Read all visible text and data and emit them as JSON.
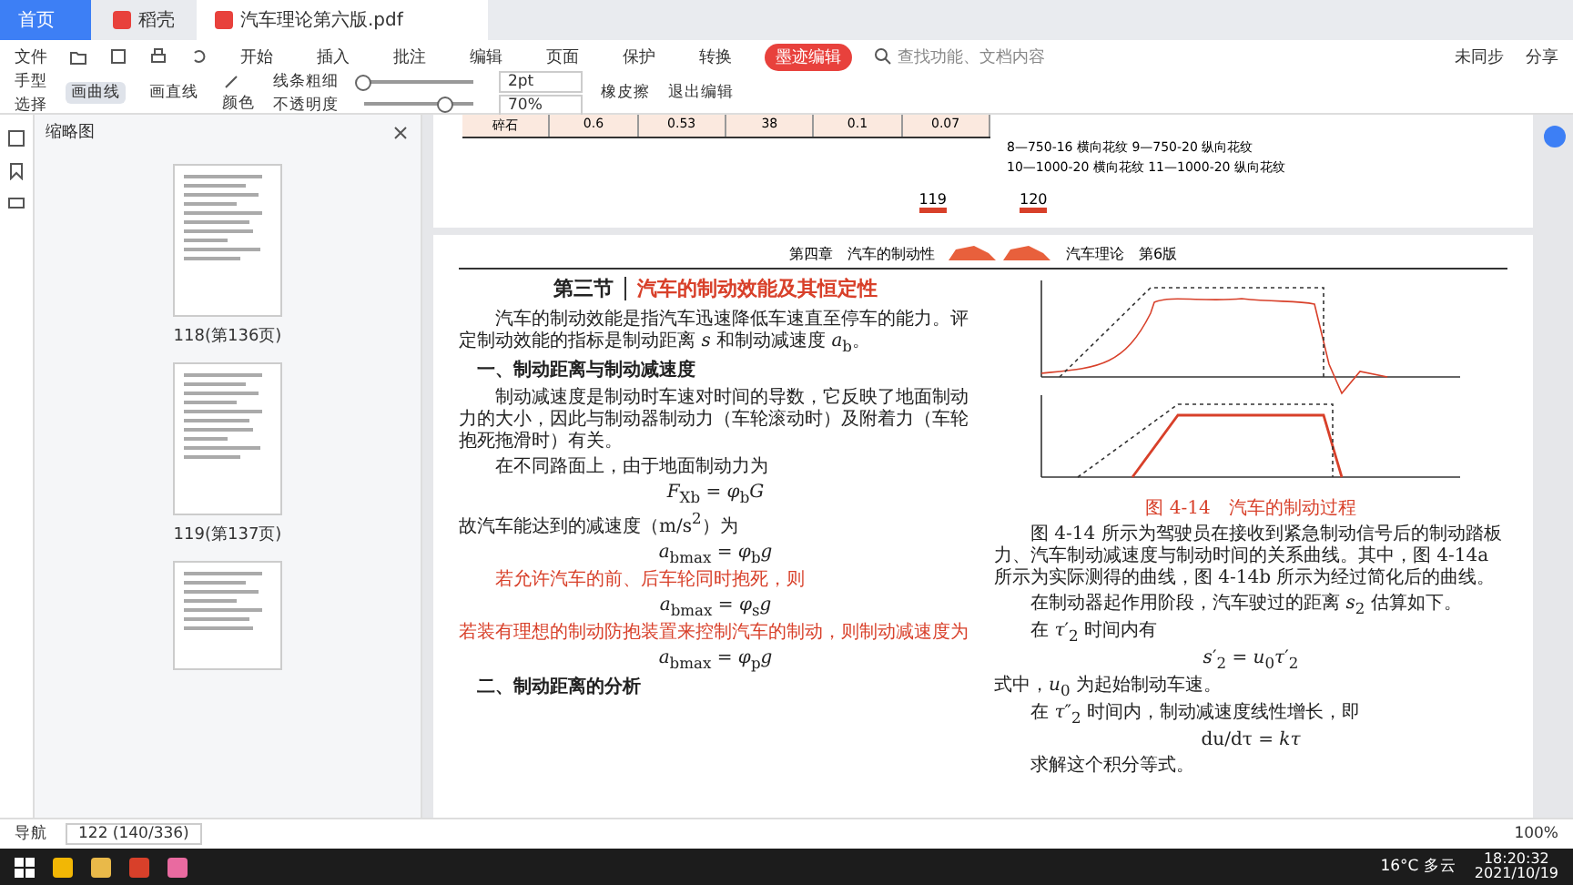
{
  "tabs": [
    {
      "label": "首页",
      "selected": false,
      "kind": "home"
    },
    {
      "label": "稻壳",
      "selected": false,
      "kind": "app"
    },
    {
      "label": "汽车理论第六版.pdf",
      "selected": true,
      "kind": "doc"
    }
  ],
  "menu": {
    "file": "文件",
    "items": [
      {
        "label": "开始",
        "selected": false
      },
      {
        "label": "插入",
        "selected": false
      },
      {
        "label": "批注",
        "selected": false
      },
      {
        "label": "编辑",
        "selected": false
      },
      {
        "label": "页面",
        "selected": false
      },
      {
        "label": "保护",
        "selected": false
      },
      {
        "label": "转换",
        "selected": false
      },
      {
        "label": "墨迹编辑",
        "selected": true
      }
    ],
    "search_placeholder": "查找功能、文档内容",
    "sync": "未同步",
    "share": "分享"
  },
  "ribbon": {
    "hand": "手型",
    "select": "选择",
    "tools": [
      {
        "label": "画曲线",
        "selected": true
      },
      {
        "label": "画直线",
        "selected": false
      }
    ],
    "color_label": "颜色",
    "thickness_label": "线条粗细",
    "opacity_label": "不透明度",
    "thickness": {
      "level": 0.05,
      "value": "2pt"
    },
    "opacity": {
      "level": 0.7,
      "value": "70%"
    },
    "eraser": "橡皮擦",
    "exit": "退出编辑"
  },
  "sidebar": {
    "title": "缩略图",
    "thumbnails": [
      {
        "label": "118(第136页)"
      },
      {
        "label": "119(第137页)"
      },
      {
        "kind": "partial"
      }
    ]
  },
  "top_page": {
    "table_row": [
      "碎石",
      "0.6",
      "0.53",
      "38",
      "0.1",
      "0.07"
    ],
    "legend": [
      "8—750-16 横向花纹  9—750-20 纵向花纹",
      "10—1000-20 横向花纹  11—1000-20 纵向花纹"
    ],
    "page_numbers": [
      "119",
      "120"
    ]
  },
  "page": {
    "header_left": "第四章　汽车的制动性",
    "header_right": "汽车理论　第6版",
    "left_column": [
      {
        "kind": "section",
        "number": "第三节",
        "title": "汽车的制动效能及其恒定性"
      },
      {
        "kind": "para",
        "text": "汽车的制动效能是指汽车迅速降低车速直至停车的能力。评定制动效能的指标是制动距离 *s* 和制动减速度 *a*$_{b}$。"
      },
      {
        "kind": "heading",
        "text": "一、制动距离与制动减速度"
      },
      {
        "kind": "para",
        "text": "制动减速度是制动时车速对时间的导数，它反映了地面制动力的大小，因此与制动器制动力（车轮滚动时）及附着力（车轮抱死拖滑时）有关。"
      },
      {
        "kind": "para",
        "text": "在不同路面上，由于地面制动力为"
      },
      {
        "kind": "formula",
        "text": "*F*$_{Xb}$ = *φ*$_{b}$*G*"
      },
      {
        "kind": "plain",
        "text": "故汽车能达到的减速度（m/s$^{2}$）为"
      },
      {
        "kind": "formula",
        "text": "*a*$_{bmax}$ = *φ*$_{b}$*g*"
      },
      {
        "kind": "red",
        "text": "若允许汽车的前、后车轮同时抱死，则"
      },
      {
        "kind": "formula",
        "text": "*a*$_{bmax}$ = *φ*$_{s}$*g*"
      },
      {
        "kind": "red_plain",
        "text": "若装有理想的制动防抱装置来控制汽车的制动，则制动减速度为"
      },
      {
        "kind": "formula",
        "text": "*a*$_{bmax}$ = *φ*$_{p}$*g*"
      },
      {
        "kind": "heading",
        "text": "二、制动距离的分析"
      }
    ],
    "figure_caption": "图 4-14　汽车的制动过程",
    "right_column": [
      {
        "kind": "para",
        "text": "图 4-14 所示为驾驶员在接收到紧急制动信号后的制动踏板力、汽车制动减速度与制动时间的关系曲线。其中，图 4-14a 所示为实际测得的曲线，图 4-14b 所示为经过简化后的曲线。"
      },
      {
        "kind": "para",
        "text": "在制动器起作用阶段，汽车驶过的距离 *s*$_{2}$ 估算如下。"
      },
      {
        "kind": "para",
        "text": "在 *τ*′$_{2}$ 时间内有"
      },
      {
        "kind": "formula",
        "text": "*s*′$_{2}$ = *u*$_{0}$*τ*′$_{2}$"
      },
      {
        "kind": "plain",
        "text": "式中，*u*$_{0}$ 为起始制动车速。"
      },
      {
        "kind": "para",
        "text": "在 *τ*″$_{2}$ 时间内，制动减速度线性增长，即"
      },
      {
        "kind": "formula",
        "text": "du/dτ = *kτ*"
      },
      {
        "kind": "para",
        "text": "求解这个积分等式。"
      }
    ]
  },
  "status": {
    "nav": "导航",
    "page": "122 (140/336)",
    "zoom": "100%"
  },
  "taskbar": {
    "weather": "16°C 多云",
    "time": "18:20:32",
    "date": "2021/10/19"
  }
}
